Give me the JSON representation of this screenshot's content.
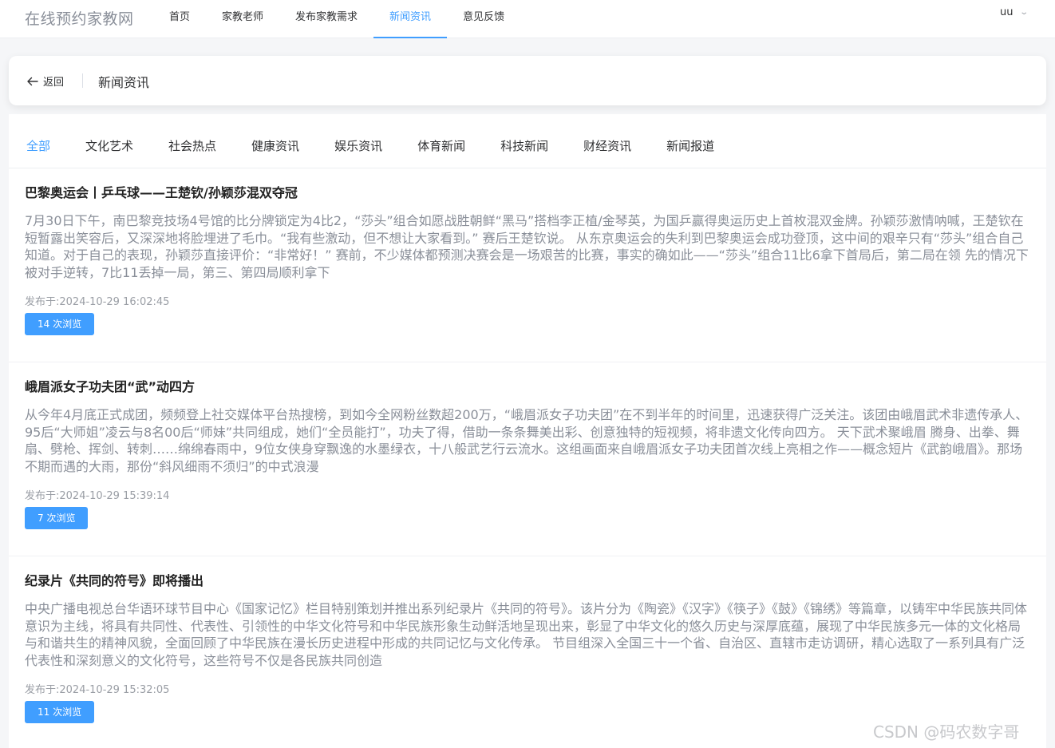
{
  "site": {
    "title": "在线预约家教网"
  },
  "nav": [
    {
      "label": "首页",
      "active": false
    },
    {
      "label": "家教老师",
      "active": false
    },
    {
      "label": "发布家教需求",
      "active": false
    },
    {
      "label": "新闻资讯",
      "active": true
    },
    {
      "label": "意见反馈",
      "active": false
    }
  ],
  "user": {
    "name": "uu",
    "icon": "chevron-down-icon"
  },
  "header": {
    "back_label": "返回",
    "back_icon": "arrow-left-icon",
    "title": "新闻资讯"
  },
  "tabs": [
    {
      "label": "全部",
      "active": true
    },
    {
      "label": "文化艺术",
      "active": false
    },
    {
      "label": "社会热点",
      "active": false
    },
    {
      "label": "健康资讯",
      "active": false
    },
    {
      "label": "娱乐资讯",
      "active": false
    },
    {
      "label": "体育新闻",
      "active": false
    },
    {
      "label": "科技新闻",
      "active": false
    },
    {
      "label": "财经资讯",
      "active": false
    },
    {
      "label": "新闻报道",
      "active": false
    }
  ],
  "articles": [
    {
      "title": "巴黎奥运会丨乒乓球——王楚钦/孙颖莎混双夺冠",
      "body": "7月30日下午，南巴黎竞技场4号馆的比分牌锁定为4比2，“莎头”组合如愿战胜朝鲜“黑马”搭档李正植/金琴英，为国乒赢得奥运历史上首枚混双金牌。孙颖莎激情呐喊，王楚钦在短暂露出笑容后，又深深地将脸埋进了毛巾。“我有些激动，但不想让大家看到。” 赛后王楚钦说。 从东京奥运会的失利到巴黎奥运会成功登顶，这中间的艰辛只有“莎头”组合自己知道。对于自己的表现，孙颖莎直接评价：“非常好！” 赛前，不少媒体都预测决赛会是一场艰苦的比赛，事实的确如此——“莎头”组合11比6拿下首局后，第二局在领 先的情况下被对手逆转，7比11丢掉一局，第三、第四局顺利拿下",
      "date": "发布于:2024-10-29 16:02:45",
      "views": "14 次浏览"
    },
    {
      "title": "峨眉派女子功夫团“武”动四方",
      "body": "从今年4月底正式成团，频频登上社交媒体平台热搜榜，到如今全网粉丝数超200万，“峨眉派女子功夫团”在不到半年的时间里，迅速获得广泛关注。该团由峨眉武术非遗传承人、95后“大师姐”凌云与8名00后“师妹”共同组成，她们“全员能打”，功夫了得，借助一条条舞美出彩、创意独特的短视频，将非遗文化传向四方。 天下武术聚峨眉 腾身、出拳、舞扇、劈枪、挥剑、转刺……绵绵春雨中，9位女侠身穿飘逸的水墨绿衣，十八般武艺行云流水。这组画面来自峨眉派女子功夫团首次线上亮相之作——概念短片《武韵峨眉》。那场不期而遇的大雨，那份“斜风细雨不须归”的中式浪漫",
      "date": "发布于:2024-10-29 15:39:14",
      "views": "7 次浏览"
    },
    {
      "title": "纪录片《共同的符号》即将播出",
      "body": "中央广播电视总台华语环球节目中心《国家记忆》栏目特别策划并推出系列纪录片《共同的符号》。该片分为《陶瓷》《汉字》《筷子》《鼓》《锦绣》等篇章，以铸牢中华民族共同体意识为主线，将具有共同性、代表性、引领性的中华文化符号和中华民族形象生动鲜活地呈现出来，彰显了中华文化的悠久历史与深厚底蕴，展现了中华民族多元一体的文化格局与和谐共生的精神风貌，全面回顾了中华民族在漫长历史进程中形成的共同记忆与文化传承。 节目组深入全国三十一个省、自治区、直辖市走访调研，精心选取了一系列具有广泛代表性和深刻意义的文化符号，这些符号不仅是各民族共同创造",
      "date": "发布于:2024-10-29 15:32:05",
      "views": "11 次浏览"
    }
  ],
  "watermark": "CSDN @码农数字哥",
  "colors": {
    "accent": "#409eff",
    "text": "#303133",
    "muted": "#8a8f99",
    "bg": "#f5f6f8"
  }
}
